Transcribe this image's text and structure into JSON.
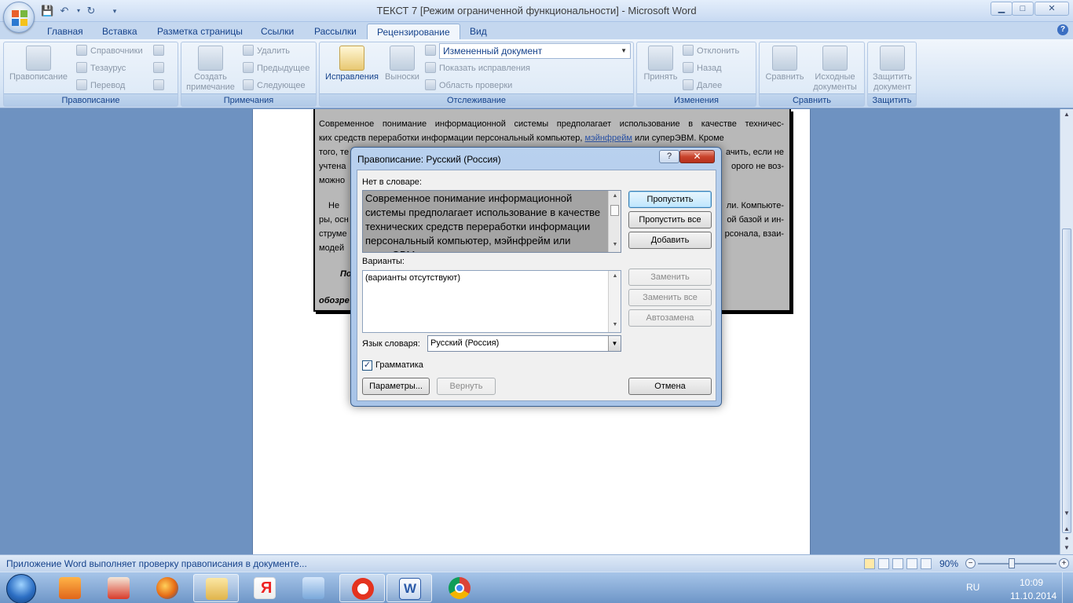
{
  "window": {
    "title": "ТЕКСТ 7 [Режим ограниченной функциональности] - Microsoft Word",
    "buttons": {
      "minimize": "▁",
      "maximize": "□",
      "close": "✕"
    }
  },
  "tabs": [
    "Главная",
    "Вставка",
    "Разметка страницы",
    "Ссылки",
    "Рассылки",
    "Рецензирование",
    "Вид"
  ],
  "active_tab": "Рецензирование",
  "ribbon": {
    "groups": {
      "spelling": {
        "label": "Правописание",
        "big": "Правописание",
        "small": [
          "Справочники",
          "Тезаурус",
          "Перевод"
        ]
      },
      "notes": {
        "label": "Примечания",
        "big": "Создать примечание",
        "small": [
          "Удалить",
          "Предыдущее",
          "Следующее"
        ]
      },
      "tracking": {
        "label": "Отслеживание",
        "big1": "Исправления",
        "big2": "Выноски",
        "select": "Измененный документ",
        "small": [
          "Показать исправления",
          "Область проверки"
        ]
      },
      "changes": {
        "label": "Изменения",
        "big": "Принять",
        "small": [
          "Отклонить",
          "Назад",
          "Далее"
        ]
      },
      "compare": {
        "label": "Сравнить",
        "big1": "Сравнить",
        "big2": "Исходные документы"
      },
      "protect": {
        "label": "Защитить",
        "big": "Защитить документ"
      }
    }
  },
  "document": {
    "lines": [
      "Современное понимание информационной системы предполагает использование в качестве техничес-",
      "ких средств переработки информации персональный компьютер,",
      "мэйнфрейм",
      "или суперЭВМ. Кроме",
      "того, те",
      "ачить, если не",
      "учтена",
      "орого не воз-",
      "можно",
      "Не",
      "ли. Компьюте-",
      "ры, осн",
      "ой базой и ин-",
      "струме",
      "рсонала, взаи-",
      "модей",
      "По",
      "обозре"
    ]
  },
  "dialog": {
    "title": "Правописание: Русский (Россия)",
    "help": "?",
    "close": "✕",
    "not_in_dict_label": "Нет в словаре:",
    "not_in_dict_text": "Современное понимание информационной системы предполагает использование в качестве технических средств переработки информации персональный компьютер, мэйнфрейм или суперЭВМ.",
    "suggestions_label": "Варианты:",
    "suggestions": [
      "(варианты отсутствуют)"
    ],
    "dict_lang_label": "Язык словаря:",
    "dict_lang": "Русский (Россия)",
    "grammar_label": "Грамматика",
    "grammar_checked": true,
    "buttons": {
      "skip": "Пропустить",
      "skip_all": "Пропустить все",
      "add": "Добавить",
      "replace": "Заменить",
      "replace_all": "Заменить все",
      "autocorrect": "Автозамена",
      "options": "Параметры...",
      "undo": "Вернуть",
      "cancel": "Отмена"
    }
  },
  "statusbar": {
    "text": "Приложение Word выполняет проверку правописания в документе...",
    "zoom": "90%",
    "zoom_value_percent": 90
  },
  "taskbar": {
    "lang": "RU",
    "time": "10:09",
    "date": "11.10.2014",
    "apps": [
      "Start",
      "Media Player",
      "Paint",
      "Firefox",
      "Explorer",
      "Yandex",
      "Sound",
      "Yandex Browser",
      "Word",
      "Chrome"
    ]
  },
  "colors": {
    "ribbon_text": "#15428b",
    "desktop": "#6b8fbe",
    "highlight": "#2b53a7"
  }
}
